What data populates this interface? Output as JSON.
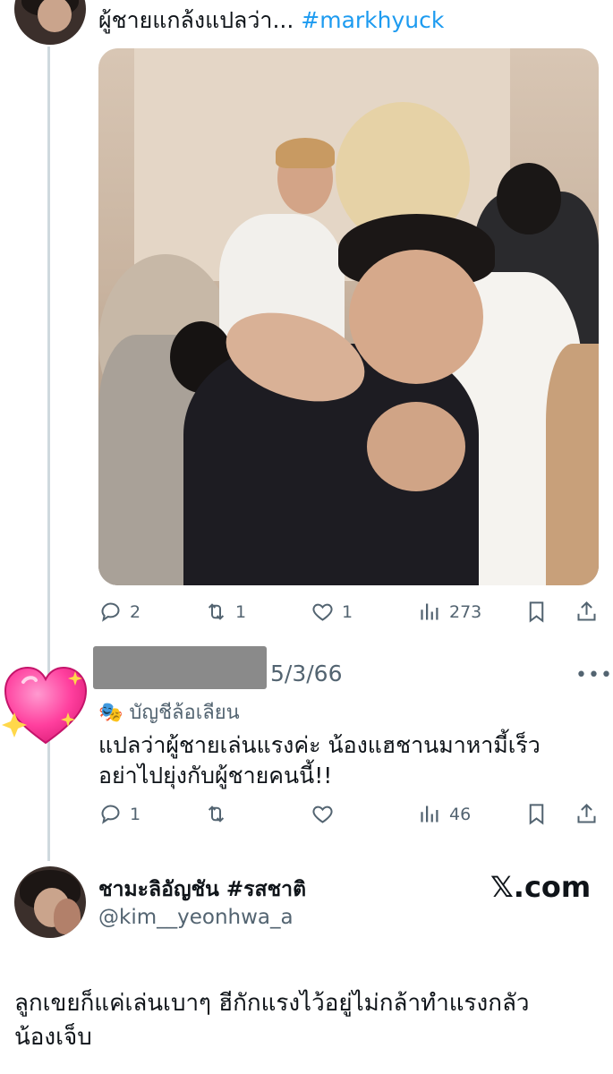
{
  "top_tweet": {
    "text_prefix": "ผู้ชายแกล้งแปลว่า...",
    "hashtag": "#markhyuck",
    "actions": {
      "replies": "2",
      "retweets": "1",
      "likes": "1",
      "views": "273"
    }
  },
  "reply": {
    "date": "5/3/66",
    "more_icon": "more-dots-icon",
    "label_icon": "theater-masks-icon",
    "label": "บัญชีล้อเลียน",
    "text_line1": "แปลว่าผู้ชายเล่นแรงค่ะ น้องแฮชานมาหามี้เร็ว",
    "text_line2": "อย่าไปยุ่งกับผู้ชายคนนี้!!",
    "actions": {
      "replies": "1",
      "views": "46"
    }
  },
  "author": {
    "display_name": "ชามะลิอัญชัน #รสชาติ",
    "handle": "@kim__yeonhwa_a",
    "watermark": "𝕏.com"
  },
  "caption": {
    "line1": "ลูกเขยก็แค่เล่นเบาๆ ฮีกักแรงไว้อยู่ไม่กล้าทำแรงกลัว",
    "line2": "น้องเจ็บ"
  },
  "colors": {
    "hashtag": "#1d9bf0",
    "muted": "#536471",
    "thread_line": "#cfd9de"
  }
}
